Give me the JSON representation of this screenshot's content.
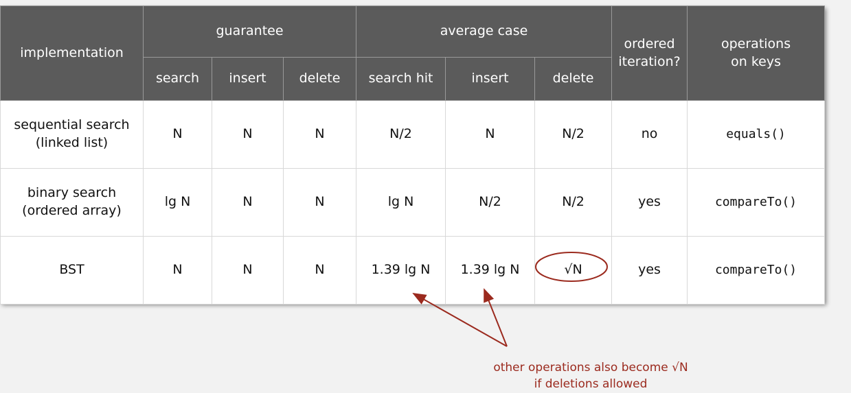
{
  "header": {
    "implementation": "implementation",
    "guarantee": "guarantee",
    "average_case": "average case",
    "ordered_iteration": [
      "ordered",
      "iteration?"
    ],
    "operations_on_keys": [
      "operations",
      "on keys"
    ],
    "sub": [
      "search",
      "insert",
      "delete",
      "search hit",
      "insert",
      "delete"
    ]
  },
  "rows": [
    {
      "impl": [
        "sequential search",
        "(linked list)"
      ],
      "cells": [
        "N",
        "N",
        "N",
        "N/2",
        "N",
        "N/2"
      ],
      "ordered": "no",
      "ops": "equals()"
    },
    {
      "impl": [
        "binary search",
        "(ordered array)"
      ],
      "cells": [
        "lg N",
        "N",
        "N",
        "lg N",
        "N/2",
        "N/2"
      ],
      "ordered": "yes",
      "ops": "compareTo()"
    },
    {
      "impl": [
        "BST"
      ],
      "cells": [
        "N",
        "N",
        "N",
        "1.39 lg N",
        "1.39 lg N",
        "√N"
      ],
      "ordered": "yes",
      "ops": "compareTo()"
    }
  ],
  "annotation": {
    "lines": [
      "other operations also become √N",
      "if deletions allowed"
    ],
    "color": "#9b2a1e"
  },
  "colors": {
    "header_bg": "#5b5b5b",
    "page_bg": "#f2f2f2"
  }
}
